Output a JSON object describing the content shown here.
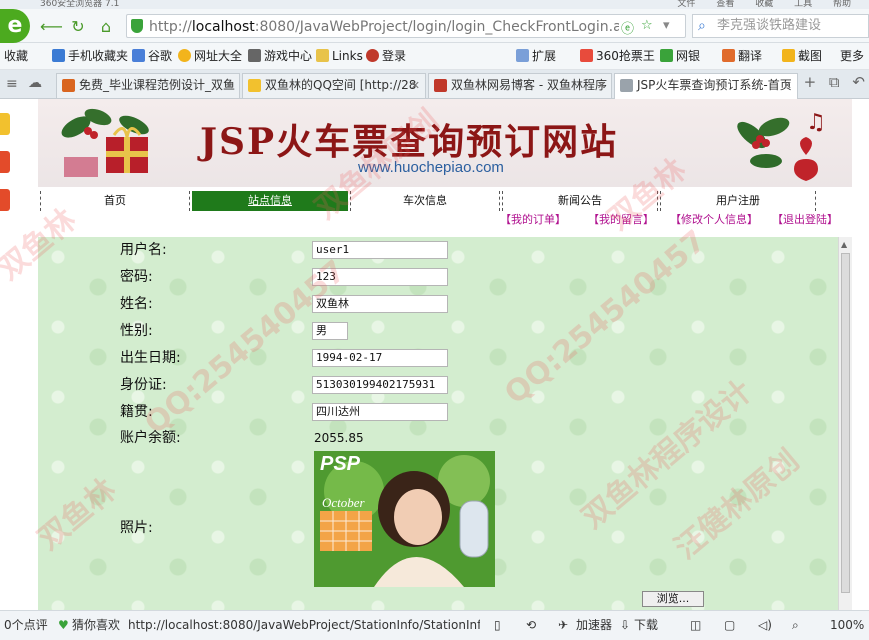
{
  "browser": {
    "title_bar": {
      "title": "360安全浏览器 7.1",
      "menu": [
        "文件",
        "查看",
        "收藏",
        "工具",
        "帮助"
      ]
    },
    "address": {
      "prefix": "http://",
      "host": "localhost",
      "rest": ":8080/JavaWebProject/login/login_CheckFrontLogin.actic"
    },
    "search": {
      "placeholder": "李克强谈铁路建设"
    },
    "favorites": [
      {
        "label": "收藏"
      },
      {
        "label": "手机收藏夹"
      },
      {
        "label": "谷歌"
      },
      {
        "label": "网址大全"
      },
      {
        "label": "游戏中心"
      },
      {
        "label": "Links"
      },
      {
        "label": "登录"
      }
    ],
    "favorites_right": [
      {
        "label": "扩展"
      },
      {
        "label": "360抢票王"
      },
      {
        "label": "网银"
      },
      {
        "label": "翻译"
      },
      {
        "label": "截图"
      },
      {
        "label": "更多"
      }
    ],
    "tabs": [
      {
        "label": "免费_毕业课程范例设计_双鱼"
      },
      {
        "label": "双鱼林的QQ空间 [http://28"
      },
      {
        "label": "双鱼林网易博客 - 双鱼林程序"
      },
      {
        "label": "JSP火车票查询预订系统-首页"
      }
    ],
    "status": {
      "left": "0个点评",
      "guess": "猜你喜欢",
      "url": "http://localhost:8080/JavaWebProject/StationInfo/StationInfo_FrontQ",
      "accelerator": "加速器",
      "download": "下载",
      "zoom": "100%"
    }
  },
  "site": {
    "title": "JSP火车票查询预订网站",
    "url": "www.huochepiao.com",
    "menu": [
      {
        "label": "首页"
      },
      {
        "label": "站点信息"
      },
      {
        "label": "车次信息"
      },
      {
        "label": "新闻公告"
      },
      {
        "label": "用户注册"
      }
    ],
    "quick_links": [
      {
        "label": "【我的订单】"
      },
      {
        "label": "【我的留言】"
      },
      {
        "label": "【修改个人信息】"
      },
      {
        "label": "【退出登陆】"
      }
    ]
  },
  "profile": {
    "fields": [
      {
        "label": "用户名:",
        "value": "user1"
      },
      {
        "label": "密码:",
        "value": "123"
      },
      {
        "label": "姓名:",
        "value": "双鱼林"
      },
      {
        "label": "性别:",
        "value": "男"
      },
      {
        "label": "出生日期:",
        "value": "1994-02-17"
      },
      {
        "label": "身份证:",
        "value": "513030199402175931"
      },
      {
        "label": "籍贯:",
        "value": "四川达州"
      }
    ],
    "balance": {
      "label": "账户余额:",
      "value": "2055.85"
    },
    "photo": {
      "label": "照片:",
      "magazine": "PSP",
      "calendar": "October"
    },
    "browse_label": "浏览..."
  },
  "watermark": {
    "texts": [
      "双鱼林",
      "QQ:254540457",
      "双鱼林原创",
      "双鱼林程序设计",
      "汪健林原创"
    ]
  },
  "colors": {
    "active_menu": "#1f7a1b",
    "site_title": "#8c1616",
    "quick_link": "#b0118f",
    "content_bg": "#d3edcf"
  }
}
